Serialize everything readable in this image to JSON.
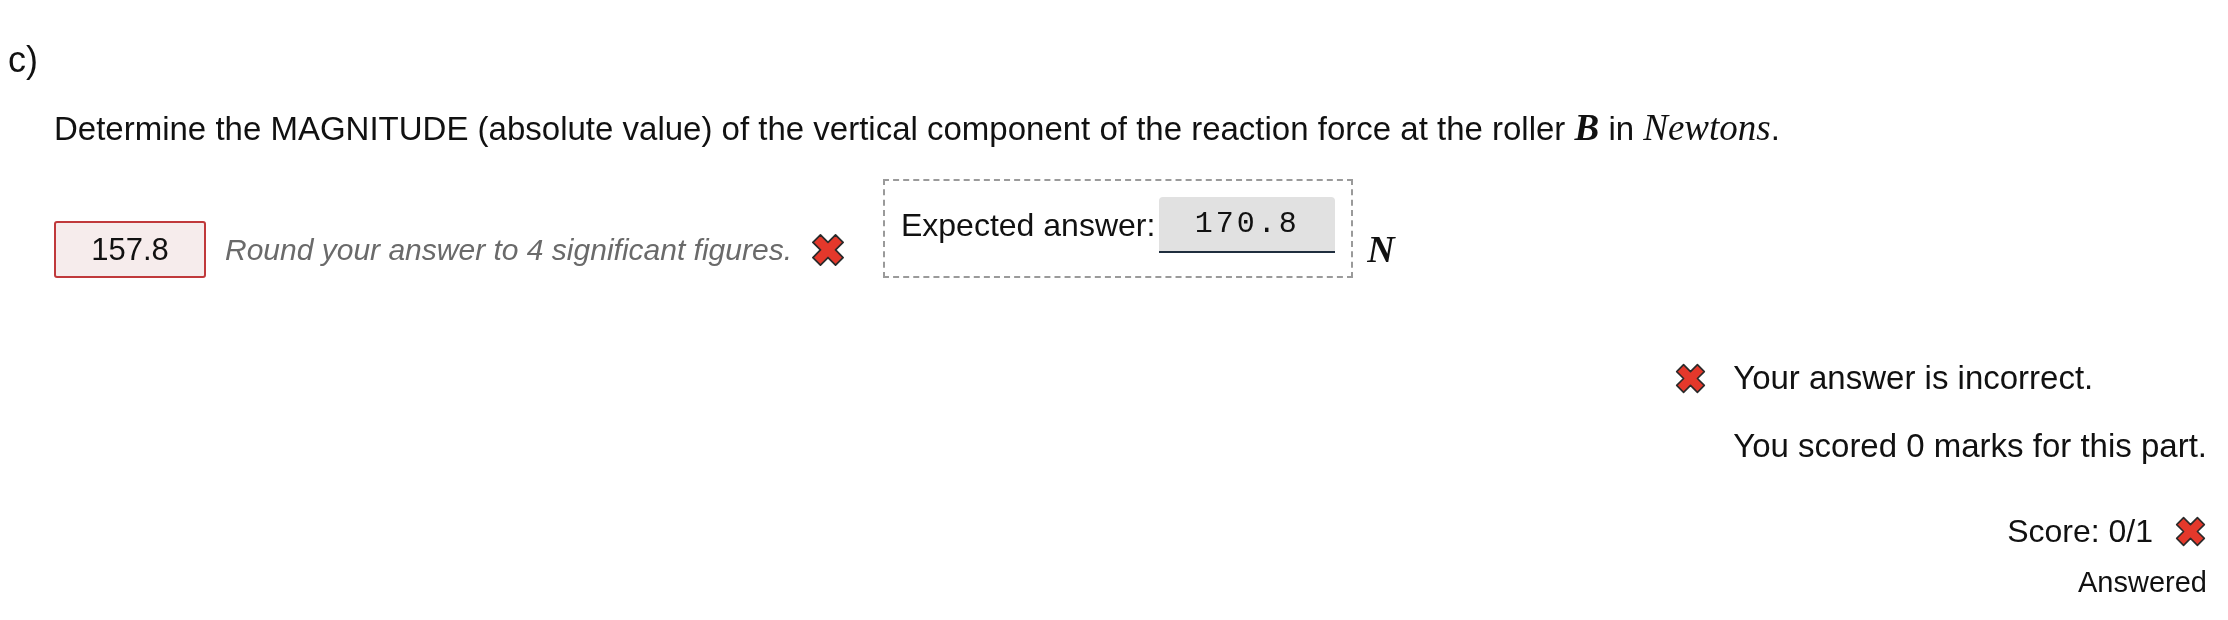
{
  "part_label": "c)",
  "question": [
    {
      "kind": "text",
      "text": "Determine the MAGNITUDE (absolute value) of the vertical component of the reaction force at the roller "
    },
    {
      "kind": "bold_math",
      "text": "B"
    },
    {
      "kind": "text",
      "text": " in "
    },
    {
      "kind": "math",
      "text": "Newtons"
    },
    {
      "kind": "text",
      "text": "."
    }
  ],
  "answer": {
    "value": "157.8",
    "correct": false,
    "hint": "Round your answer to 4 significant figures."
  },
  "expected_answer": {
    "label": "Expected answer:",
    "value": "170.8"
  },
  "unit": "N",
  "feedback": {
    "correct": false,
    "messages": [
      "Your answer is incorrect.",
      "You scored 0 marks for this part."
    ]
  },
  "score": {
    "text": "Score: 0/1",
    "correct": false,
    "status": "Answered"
  }
}
